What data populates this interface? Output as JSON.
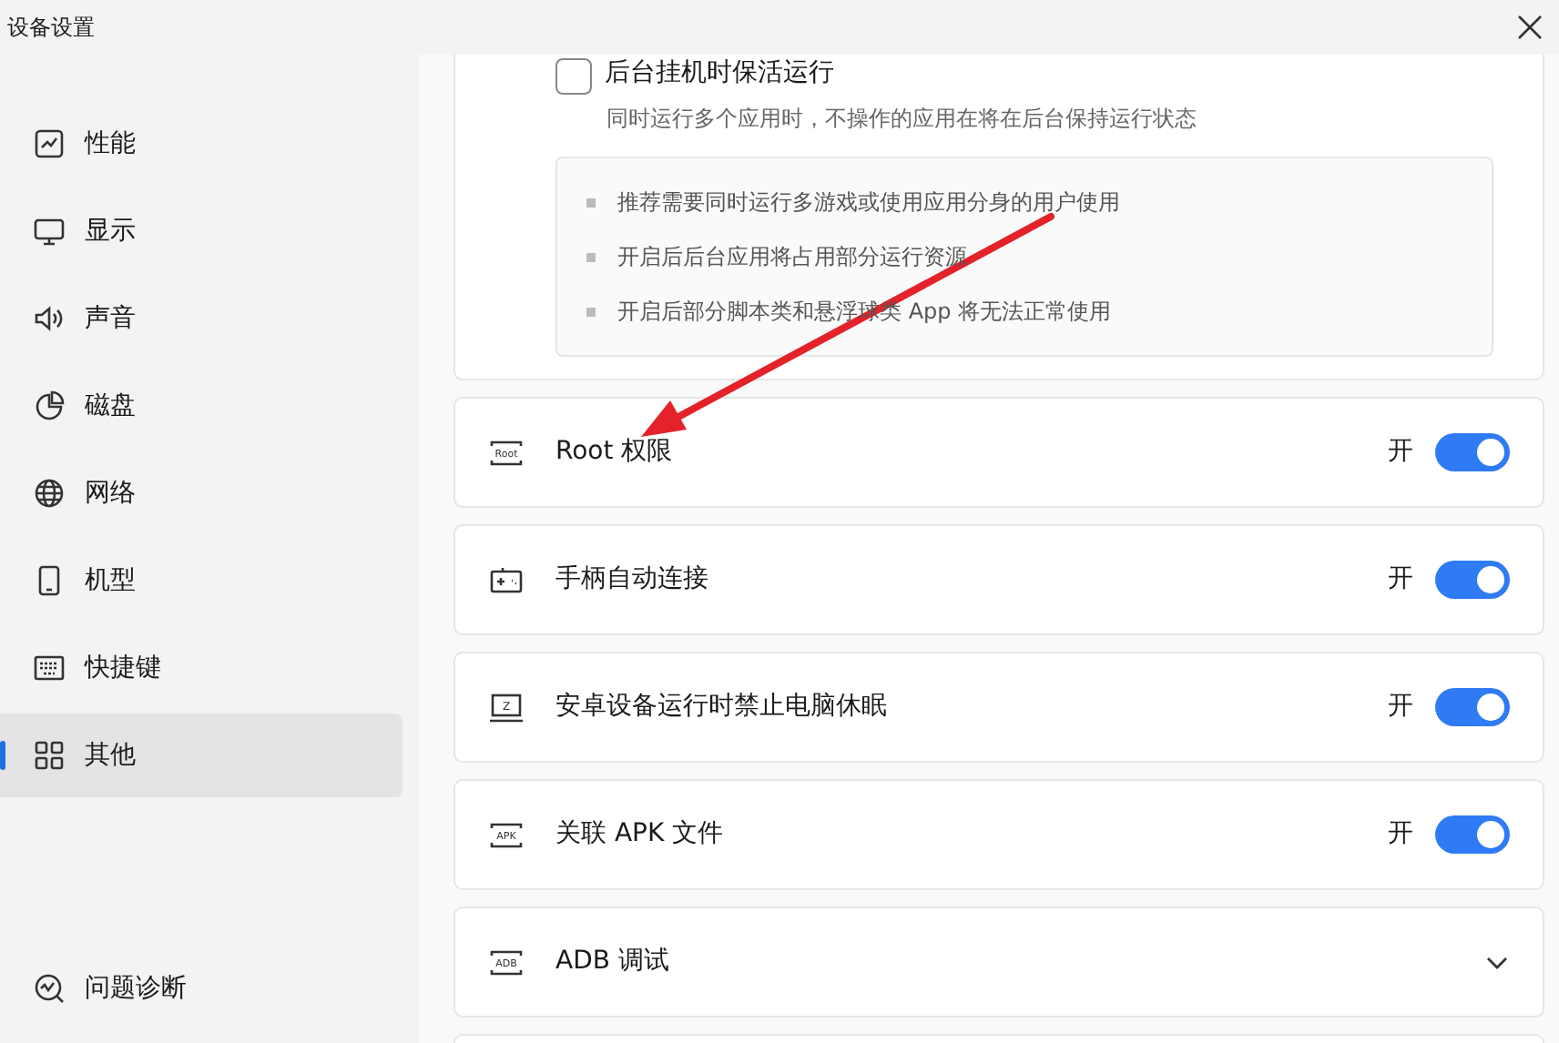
{
  "window": {
    "title": "设备设置"
  },
  "sidebar": {
    "items": [
      {
        "label": "性能",
        "selected": false
      },
      {
        "label": "显示",
        "selected": false
      },
      {
        "label": "声音",
        "selected": false
      },
      {
        "label": "磁盘",
        "selected": false
      },
      {
        "label": "网络",
        "selected": false
      },
      {
        "label": "机型",
        "selected": false
      },
      {
        "label": "快捷键",
        "selected": false
      },
      {
        "label": "其他",
        "selected": true
      }
    ],
    "footer": {
      "label": "问题诊断"
    }
  },
  "keepalive": {
    "label": "后台挂机时保活运行",
    "checked": false,
    "description": "同时运行多个应用时，不操作的应用在将在后台保持运行状态",
    "notes": [
      "推荐需要同时运行多游戏或使用应用分身的用户使用",
      "开启后后台应用将占用部分运行资源",
      "开启后部分脚本类和悬浮球类 App 将无法正常使用"
    ]
  },
  "rows": [
    {
      "kind": "toggle",
      "icon_text": "Root",
      "label": "Root 权限",
      "state_label": "开",
      "on": true
    },
    {
      "kind": "toggle",
      "label": "手柄自动连接",
      "state_label": "开",
      "on": true
    },
    {
      "kind": "toggle",
      "icon_text": "Z",
      "label": "安卓设备运行时禁止电脑休眠",
      "state_label": "开",
      "on": true
    },
    {
      "kind": "toggle",
      "icon_text": "APK",
      "label": "关联 APK 文件",
      "state_label": "开",
      "on": true
    },
    {
      "kind": "expand",
      "icon_text": "ADB",
      "label": "ADB 调试",
      "expanded": false
    }
  ]
}
